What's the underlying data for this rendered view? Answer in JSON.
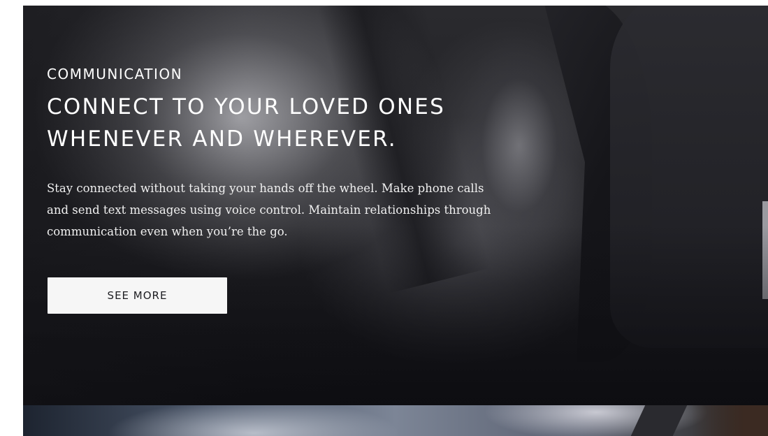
{
  "hero": {
    "eyebrow": "COMMUNICATION",
    "headline": "CONNECT TO YOUR LOVED ONES WHENEVER AND WHEREVER.",
    "body": "Stay connected without taking your hands off the wheel. Make phone calls and send text messages using voice control. Maintain relationships through communication even when you’re the go.",
    "cta_label": "SEE MORE"
  },
  "colors": {
    "text": "#ffffff",
    "button_bg": "#f6f6f6",
    "button_text": "#1e1e22",
    "hero_bg": "#1f1f23"
  }
}
